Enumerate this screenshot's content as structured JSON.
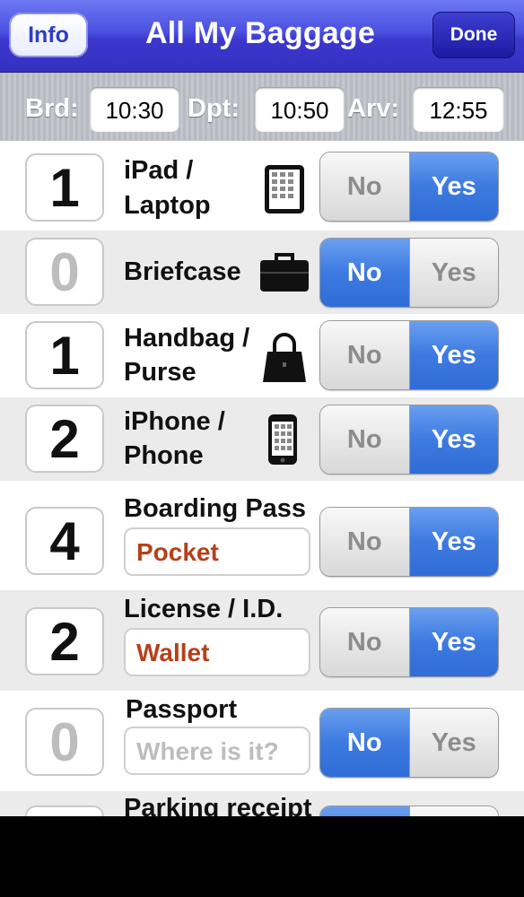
{
  "nav": {
    "title": "All My Baggage",
    "info_label": "Info",
    "done_label": "Done"
  },
  "times": {
    "boarding_label": "Brd:",
    "boarding_value": "10:30",
    "departure_label": "Dpt:",
    "departure_value": "10:50",
    "arrival_label": "Arv:",
    "arrival_value": "12:55"
  },
  "toggle": {
    "no_label": "No",
    "yes_label": "Yes"
  },
  "items": [
    {
      "count": "1",
      "line1": "iPad /",
      "line2": "Laptop",
      "icon": "tablet-icon",
      "state": "Yes"
    },
    {
      "count": "0",
      "line1": "Briefcase",
      "icon": "briefcase-icon",
      "state": "No"
    },
    {
      "count": "1",
      "line1": "Handbag /",
      "line2": "Purse",
      "icon": "handbag-icon",
      "state": "Yes"
    },
    {
      "count": "2",
      "line1": "iPhone /",
      "line2": "Phone",
      "icon": "phone-icon",
      "state": "Yes"
    },
    {
      "count": "4",
      "line1": "Boarding Pass",
      "location": "Pocket",
      "state": "Yes"
    },
    {
      "count": "2",
      "line1": "License / I.D.",
      "location": "Wallet",
      "state": "Yes"
    },
    {
      "count": "0",
      "line1": "Passport",
      "location_placeholder": "Where is it?",
      "state": "No"
    },
    {
      "line1": "Parking receipt"
    }
  ],
  "colors": {
    "nav_blue": "#3b37cf",
    "toggle_on": "#3d7ae0",
    "location_text": "#b4401a",
    "alt_row": "#ebebeb"
  }
}
